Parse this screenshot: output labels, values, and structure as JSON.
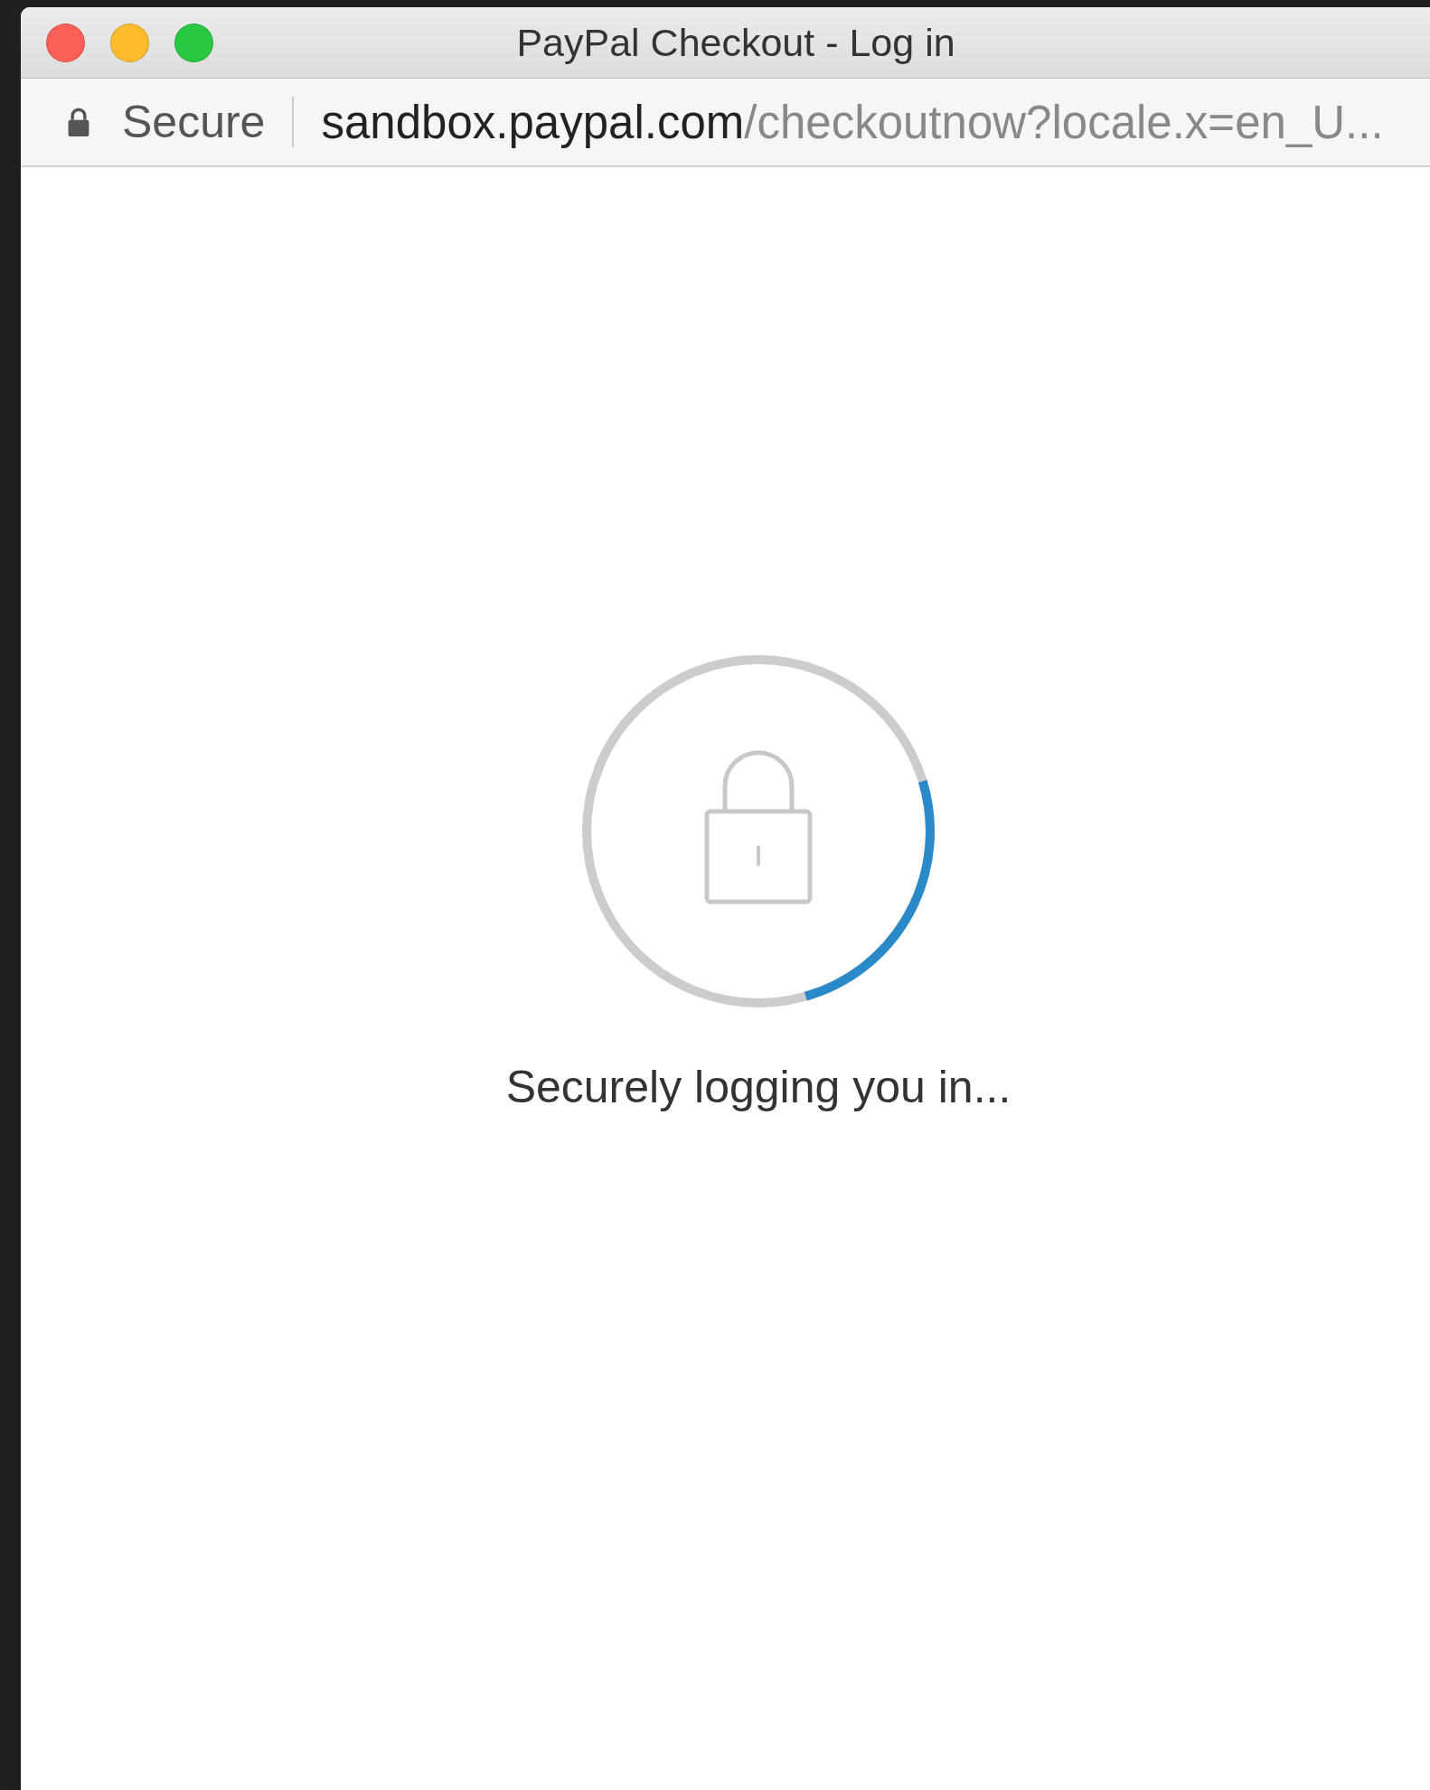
{
  "window": {
    "title": "PayPal Checkout - Log in"
  },
  "address_bar": {
    "security_label": "Secure",
    "url_host": "sandbox.paypal.com",
    "url_path": "/checkoutnow?locale.x=en_U..."
  },
  "content": {
    "message": "Securely logging you in..."
  }
}
